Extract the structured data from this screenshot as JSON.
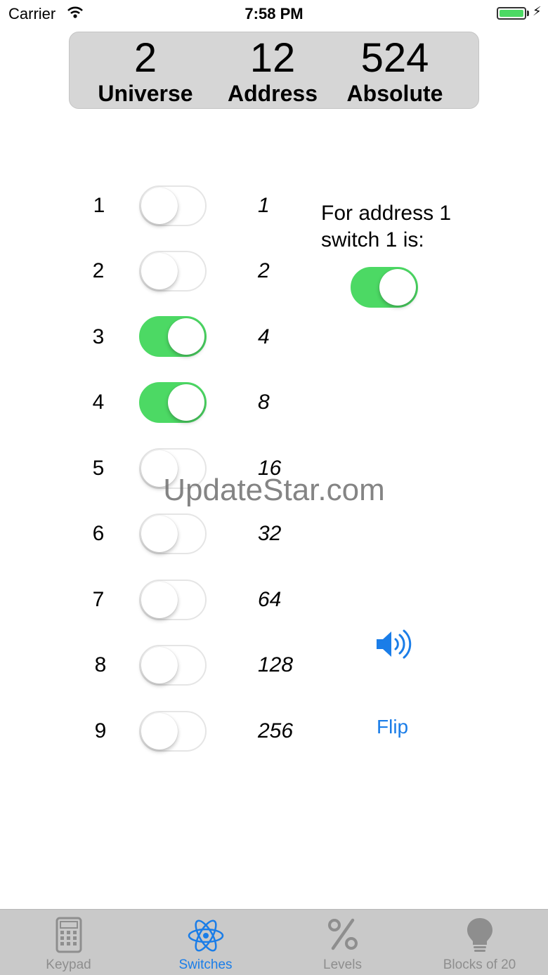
{
  "status_bar": {
    "carrier": "Carrier",
    "time": "7:58 PM"
  },
  "header": {
    "universe_value": "2",
    "universe_label": "Universe",
    "address_value": "12",
    "address_label": "Address",
    "absolute_value": "524",
    "absolute_label": "Absolute"
  },
  "switches": [
    {
      "num": "1",
      "value": "1",
      "on": false
    },
    {
      "num": "2",
      "value": "2",
      "on": false
    },
    {
      "num": "3",
      "value": "4",
      "on": true
    },
    {
      "num": "4",
      "value": "8",
      "on": true
    },
    {
      "num": "5",
      "value": "16",
      "on": false
    },
    {
      "num": "6",
      "value": "32",
      "on": false
    },
    {
      "num": "7",
      "value": "64",
      "on": false
    },
    {
      "num": "8",
      "value": "128",
      "on": false
    },
    {
      "num": "9",
      "value": "256",
      "on": false
    }
  ],
  "info": {
    "line1": "For address 1",
    "line2": "switch 1 is:",
    "switch_on": true
  },
  "flip_label": "Flip",
  "watermark": "UpdateStar.com",
  "tabs": [
    {
      "label": "Keypad",
      "icon": "calculator-icon",
      "active": false
    },
    {
      "label": "Switches",
      "icon": "atom-icon",
      "active": true
    },
    {
      "label": "Levels",
      "icon": "percent-icon",
      "active": false
    },
    {
      "label": "Blocks of 20",
      "icon": "lightbulb-icon",
      "active": false
    }
  ],
  "colors": {
    "accent": "#1a7de8",
    "switch_on": "#4cd964",
    "header_bg": "#d6d6d6",
    "tabbar_bg": "#c9c9c9"
  }
}
